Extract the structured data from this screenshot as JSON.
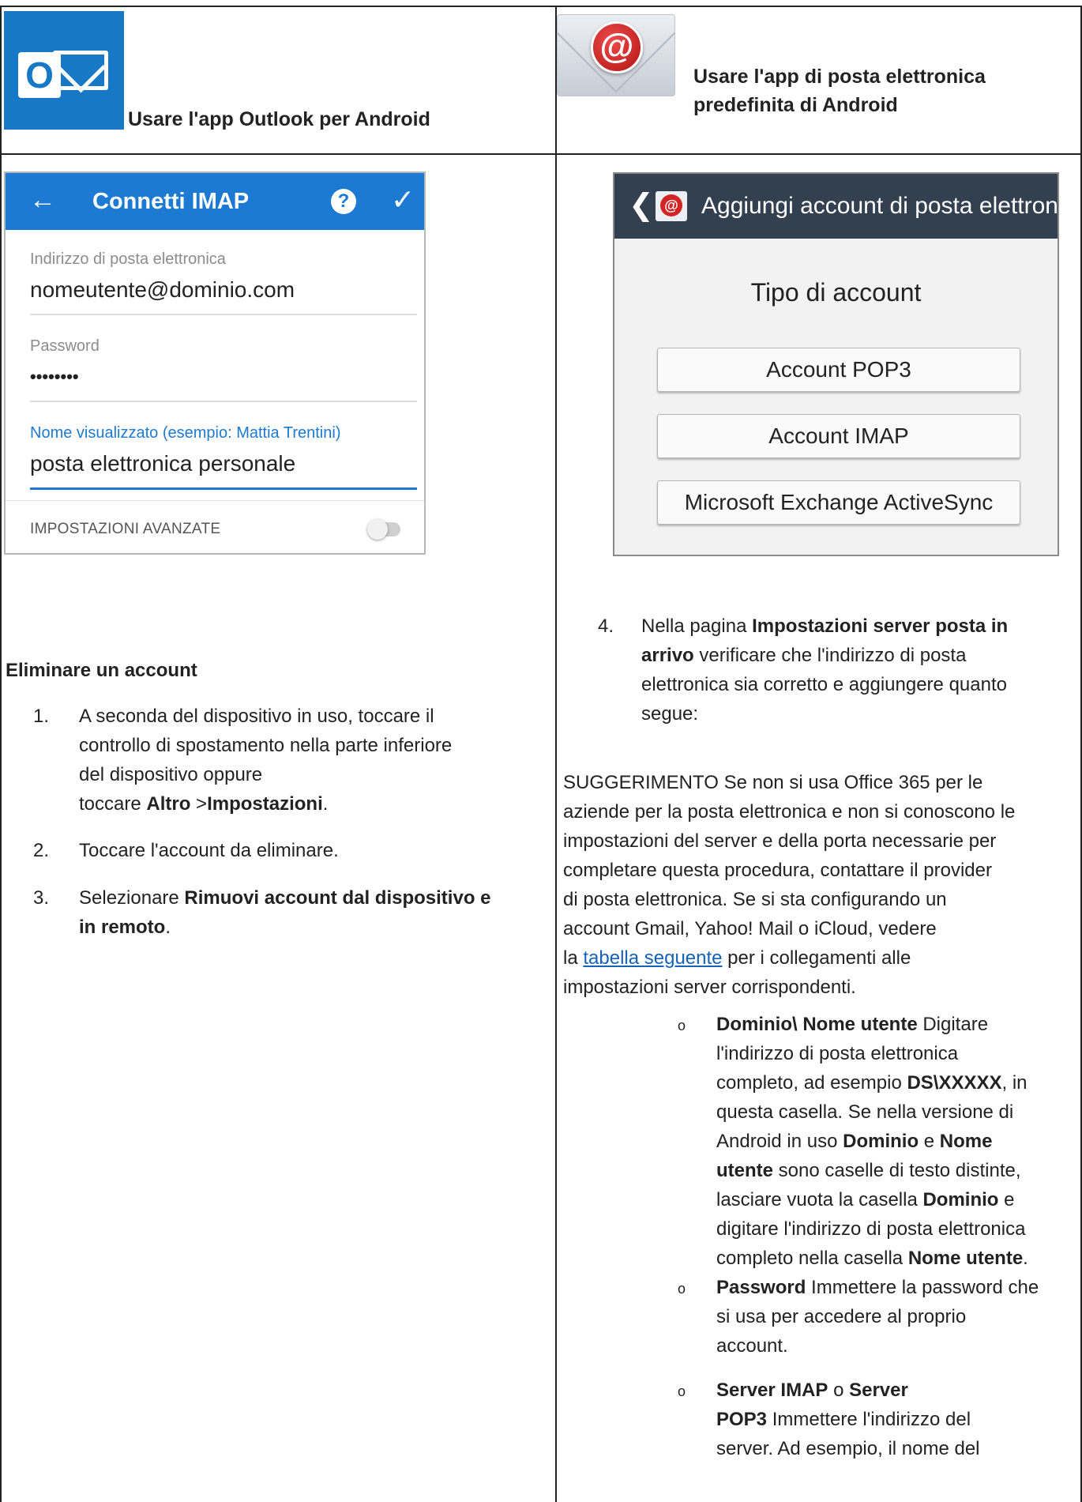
{
  "header": {
    "outlook_label": "Usare l'app Outlook per Android",
    "email_label_line1": "Usare l'app di posta elettronica",
    "email_label_line2": "predefinita di Android"
  },
  "imap_screen": {
    "title": "Connetti IMAP",
    "back_icon": "←",
    "help_icon": "?",
    "ok_icon": "✓",
    "email_label": "Indirizzo di posta elettronica",
    "email_value": "nomeutente@dominio.com",
    "password_label": "Password",
    "password_value": "••••••••",
    "display_label": "Nome visualizzato (esempio: Mattia Trentini)",
    "display_value": "posta elettronica personale",
    "advanced_label": "IMPOSTAZIONI AVANZATE",
    "advanced_on": false
  },
  "add_account_screen": {
    "title": "Aggiungi account di posta elettronica",
    "back_icon": "❮",
    "heading": "Tipo di account",
    "buttons": [
      "Account POP3",
      "Account IMAP",
      "Microsoft Exchange ActiveSync"
    ]
  },
  "delete_section": {
    "title": "Eliminare un account",
    "steps": [
      {
        "num": "1.",
        "line1": "A seconda del dispositivo in uso, toccare il",
        "line2": "controllo di spostamento nella parte inferiore",
        "line3": "del dispositivo oppure",
        "line4_pre": "toccare ",
        "line4_b1": "Altro",
        "line4_mid": " >",
        "line4_b2": "Impostazioni",
        "line4_post": "."
      },
      {
        "num": "2.",
        "line1": "Toccare l'account da eliminare."
      },
      {
        "num": "3.",
        "line1_pre": "Selezionare ",
        "line1_b": "Rimuovi account dal dispositivo e",
        "line2_b": "in remoto",
        "line2_post": "."
      }
    ]
  },
  "step4": {
    "num": "4.",
    "line1_pre": "Nella pagina ",
    "line1_b": "Impostazioni server posta in",
    "line2_b": "arrivo",
    "line2_post": " verificare che l'indirizzo di posta",
    "line3": "elettronica sia corretto e aggiungere quanto",
    "line4": "segue:"
  },
  "tip": {
    "line1": "SUGGERIMENTO   Se non si usa Office 365 per le",
    "line2": "aziende per la posta elettronica e non si conoscono le",
    "line3": "impostazioni del server e della porta necessarie per",
    "line4": "completare questa procedura, contattare il provider",
    "line5": "di posta elettronica. Se si sta configurando un",
    "line6": "account Gmail, Yahoo! Mail o iCloud, vedere",
    "line7_pre": "la ",
    "line7_link": "tabella seguente",
    "line7_post": " per i collegamenti alle",
    "line8": "impostazioni server corrispondenti."
  },
  "fields": {
    "bullet": "o",
    "domain": {
      "l1_b": "Dominio\\ Nome utente",
      "l1_post": " Digitare",
      "l2": "l'indirizzo di posta elettronica",
      "l3_pre": "completo, ad esempio ",
      "l3_b": "DS\\XXXXX",
      "l3_post": ", in",
      "l4": "questa casella. Se nella versione di",
      "l5_pre": "Android in uso ",
      "l5_b1": "Dominio",
      "l5_mid": " e ",
      "l5_b2": "Nome",
      "l6_b": "utente",
      "l6_post": " sono caselle di testo distinte,",
      "l7_pre": "lasciare vuota la casella ",
      "l7_b": "Dominio",
      "l7_post": " e",
      "l8": "digitare l'indirizzo di posta elettronica",
      "l9_pre": "completo nella casella ",
      "l9_b": "Nome utente",
      "l9_post": "."
    },
    "password": {
      "l1_b": "Password",
      "l1_post": " Immettere la password che",
      "l2": "si usa per accedere al proprio",
      "l3": "account."
    },
    "server": {
      "l1_b1": "Server IMAP",
      "l1_mid": " o ",
      "l1_b2": "Server",
      "l2_b": "POP3",
      "l2_post": " Immettere l'indirizzo del",
      "l3": "server. Ad esempio, il nome del"
    }
  }
}
